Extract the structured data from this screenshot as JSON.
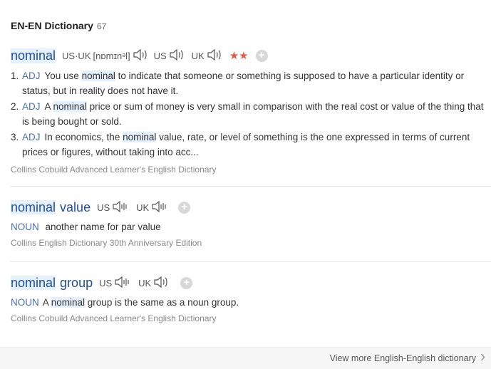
{
  "header": {
    "title": "EN-EN Dictionary",
    "count": "67"
  },
  "entries": [
    {
      "headword_parts": [
        "nominal"
      ],
      "pron_ipa_label": "US·UK",
      "pron_ipa": "[nɒmɪnᵊl]",
      "us_label": "US",
      "uk_label": "UK",
      "stars": "★★",
      "senses": [
        {
          "num": "1.",
          "pos": "ADJ",
          "pre": "You use ",
          "hl": "nominal",
          "post": " to indicate that someone or something is supposed to have a particular identity or status, but in reality does not have it."
        },
        {
          "num": "2.",
          "pos": "ADJ",
          "pre": "A ",
          "hl": "nominal",
          "post": " price or sum of money is very small in comparison with the real cost or value of the thing that is being bought or sold."
        },
        {
          "num": "3.",
          "pos": "ADJ",
          "pre": "In economics, the ",
          "hl": "nominal",
          "post": " value, rate, or level of something is the one expressed in terms of current prices or figures, without taking into acc..."
        }
      ],
      "source": "Collins Cobuild Advanced Learner's English Dictionary"
    },
    {
      "headword_hl": "nominal",
      "headword_rest": "value",
      "us_label": "US",
      "uk_label": "UK",
      "pos": "NOUN",
      "definition": "another name for par value",
      "source": "Collins English Dictionary 30th Anniversary Edition"
    },
    {
      "headword_hl": "nominal",
      "headword_rest": "group",
      "us_label": "US",
      "uk_label": "UK",
      "pos": "NOUN",
      "def_pre": "A ",
      "def_hl": "nominal",
      "def_post": " group is the same as a noun group.",
      "source": "Collins Cobuild Advanced Learner's English Dictionary"
    }
  ],
  "footer": {
    "link": "View more English-English dictionary"
  },
  "colors": {
    "headword": "#1f4e9c",
    "pos": "#4a6fb5",
    "stars": "#e0594a",
    "highlight": "#e4f0fb"
  },
  "icons": [
    "speaker-icon",
    "plus-icon",
    "chevron-right-icon"
  ]
}
